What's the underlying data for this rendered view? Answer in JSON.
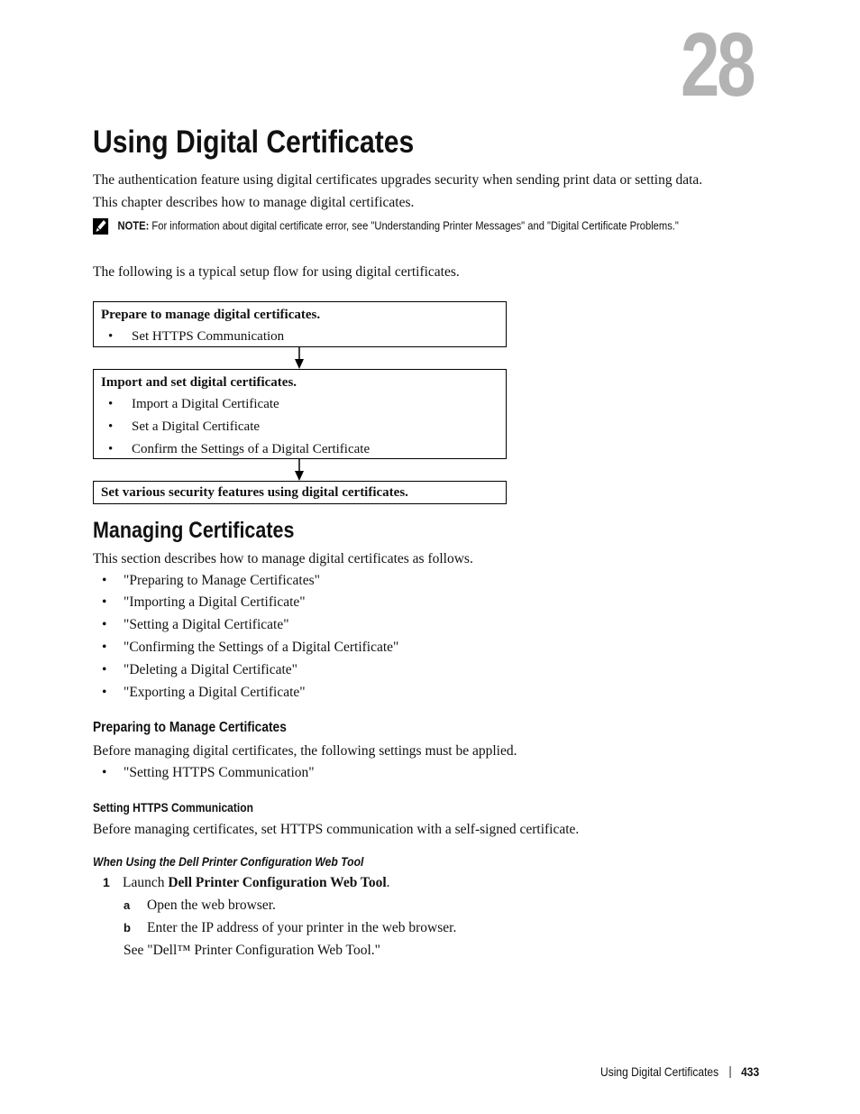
{
  "chapter": {
    "number": "28",
    "title": "Using Digital Certificates",
    "intro": [
      "The authentication feature using digital certificates upgrades security when sending print data or setting data.",
      "This chapter describes how to manage digital certificates."
    ],
    "note": {
      "icon": "pencil-note-icon",
      "label": "NOTE:",
      "text": "For information about digital certificate error, see \"Understanding Printer Messages\" and \"Digital Certificate Problems.\""
    },
    "flow_intro": "The following is a typical setup flow for using digital certificates."
  },
  "flow": [
    {
      "title": "Prepare to manage digital certificates.",
      "items": [
        "Set HTTPS Communication"
      ]
    },
    {
      "title": "Import and set digital certificates.",
      "items": [
        "Import a Digital Certificate",
        "Set a Digital Certificate",
        "Confirm the Settings of a Digital Certificate"
      ]
    },
    {
      "title": "Set various security features using digital certificates.",
      "items": []
    }
  ],
  "managing": {
    "heading": "Managing Certificates",
    "intro": "This section describes how to manage digital certificates as follows.",
    "links": [
      "\"Preparing to Manage Certificates\"",
      "\"Importing a Digital Certificate\"",
      "\"Setting a Digital Certificate\"",
      "\"Confirming the Settings of a Digital Certificate\"",
      "\"Deleting a Digital Certificate\"",
      "\"Exporting a Digital Certificate\""
    ]
  },
  "preparing": {
    "heading": "Preparing to Manage Certificates",
    "intro": "Before managing digital certificates, the following settings must be applied.",
    "links": [
      "\"Setting HTTPS Communication\""
    ]
  },
  "https": {
    "heading": "Setting HTTPS Communication",
    "intro": "Before managing certificates, set HTTPS communication with a self-signed certificate."
  },
  "webtool": {
    "heading": "When Using the Dell Printer Configuration Web Tool",
    "step1": {
      "num": "1",
      "pre": "Launch ",
      "bold": "Dell Printer Configuration Web Tool",
      "post": "."
    },
    "substeps": [
      {
        "letter": "a",
        "text": "Open the web browser."
      },
      {
        "letter": "b",
        "text": "Enter the IP address of your printer in the web browser."
      }
    ],
    "see": "See \"Dell™ Printer Configuration Web Tool.\""
  },
  "footer": {
    "title": "Using Digital Certificates",
    "page": "433"
  },
  "bullet": "•"
}
